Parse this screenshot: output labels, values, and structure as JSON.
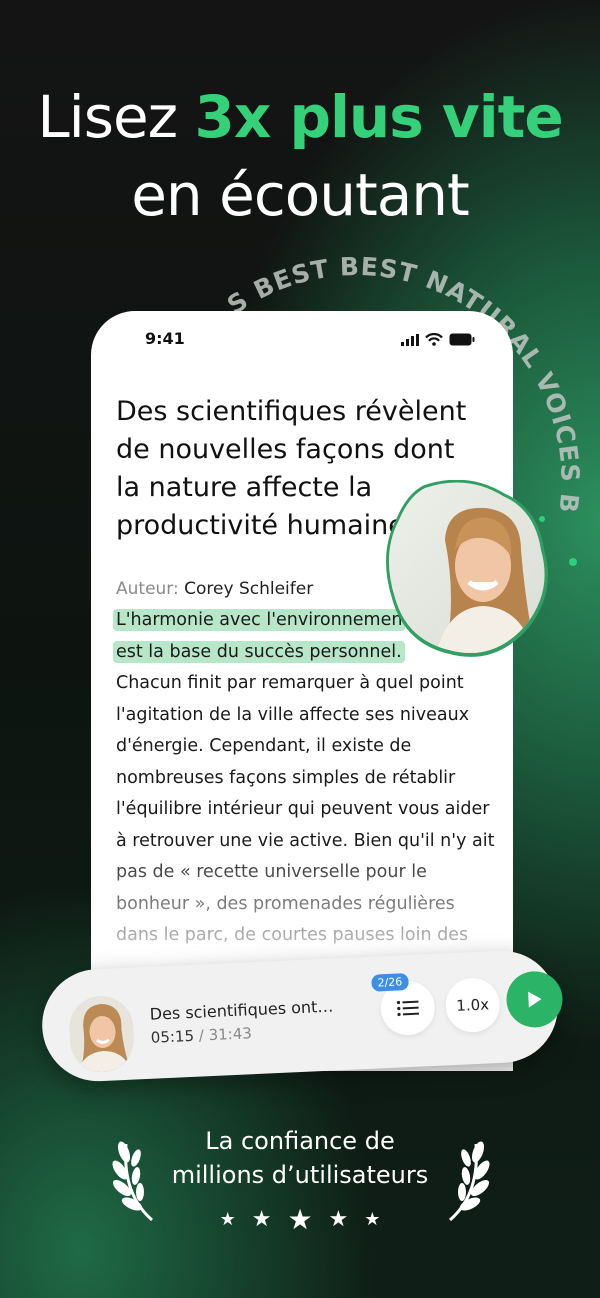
{
  "headline": {
    "line1_prefix": "Lisez ",
    "line1_accent": "3x plus vite",
    "line2": "en écoutant"
  },
  "badge_arc": {
    "text": "S BEST BEST NATURAL VOICES BES"
  },
  "phone": {
    "status_time": "9:41",
    "article_title": "Des scientifiques révèlent de nouvelles façons dont la nature affecte la productivité humaine.",
    "author_label": "Auteur:",
    "author_name": "Corey Schleifer",
    "highlight_line1": "L'harmonie avec l'environnemen",
    "highlight_line2": "est la base du succès personnel.",
    "body": "Chacun finit par remarquer à quel point l'agitation de la ville affecte ses niveaux d'énergie. Cependant, il existe de nombreuses façons simples de rétablir l'équilibre intérieur qui peuvent vous aider à retrouver une vie active. Bien qu'il n'y ait pas de « recette universelle pour le bonheur », des promenades régulières dans le parc, de courtes pauses loin des"
  },
  "player": {
    "title": "Des scientifiques ont…",
    "current_time": "05:15",
    "total_time": " / 31:43",
    "badge": "2/26",
    "speed": "1.0x",
    "accent_color": "#2bb467"
  },
  "trust": {
    "line1": "La confiance de",
    "line2": "millions d’utilisateurs",
    "rating": 5
  },
  "colors": {
    "accent": "#34d17a",
    "highlight": "#b7e6c9"
  }
}
